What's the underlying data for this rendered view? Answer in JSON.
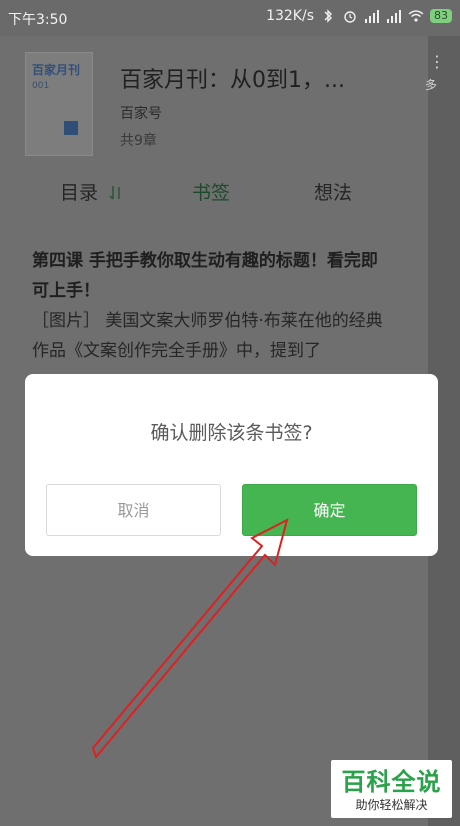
{
  "status_bar": {
    "time": "下午3:50",
    "speed": "132K/s",
    "battery": "83",
    "icons": [
      "bluetooth-icon",
      "alarm-icon",
      "signal-icon",
      "signal-icon",
      "wifi-icon",
      "battery-icon"
    ]
  },
  "book": {
    "cover_title": "百家月刊",
    "cover_number": "001",
    "title": "百家月刊：从0到1，...",
    "author": "百家号",
    "chapters": "共9章"
  },
  "right_strip": {
    "more": "多"
  },
  "tabs": [
    {
      "label": "目录"
    },
    {
      "label": "书签"
    },
    {
      "label": "想法"
    }
  ],
  "content": {
    "heading": "第四课 手把手教你取生动有趣的标题！看完即可上手！",
    "body": "［图片］ 美国文案大师罗伯特·布莱在他的经典作品《文案创作完全手册》中，提到了"
  },
  "dialog": {
    "message": "确认删除该条书签?",
    "cancel_label": "取消",
    "ok_label": "确定"
  },
  "annotation": {
    "arrow_color": "#e02020"
  },
  "watermark": {
    "title": "百科全说",
    "subtitle": "助你轻松解决"
  }
}
